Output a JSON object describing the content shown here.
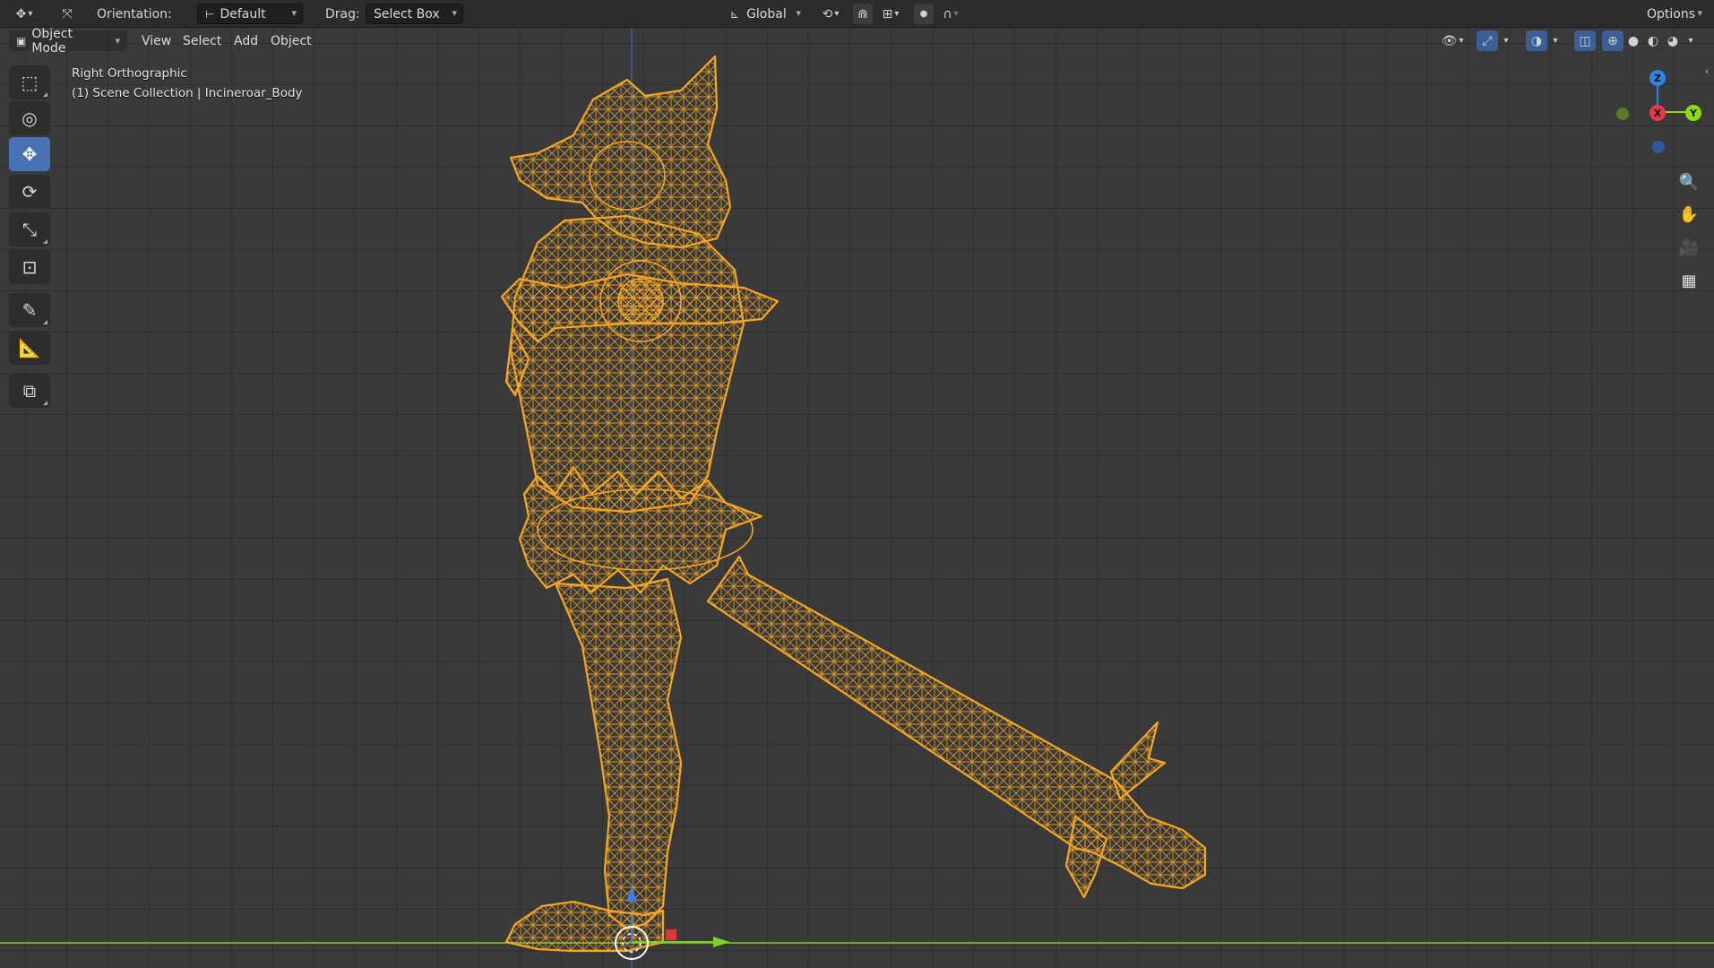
{
  "tool_header": {
    "orientation_label": "Orientation:",
    "orientation_value": "Default",
    "drag_label": "Drag:",
    "drag_value": "Select Box",
    "transform_orientation": "Global",
    "options_label": "Options"
  },
  "viewport_header": {
    "mode": "Object Mode",
    "menus": [
      "View",
      "Select",
      "Add",
      "Object"
    ]
  },
  "viewport_info": {
    "view_name": "Right Orthographic",
    "collection_path": "(1) Scene Collection | Incineroar_Body"
  },
  "toolbar": {
    "tools": [
      "select-box",
      "cursor",
      "move",
      "rotate",
      "scale",
      "transform",
      "annotate",
      "measure",
      "add-cube"
    ],
    "active": "move"
  },
  "gizmo": {
    "axes": [
      "Z",
      "X",
      "Y"
    ],
    "colors": {
      "x": "#e8384f",
      "y": "#8bdc00",
      "z": "#2f83e3"
    }
  },
  "colors": {
    "wireframe": "#f5a623",
    "grid_bg": "#3a3a3a",
    "active_tool": "#4772b3",
    "x_axis_line": "#d6454a",
    "y_axis_line": "#6fa82a"
  }
}
